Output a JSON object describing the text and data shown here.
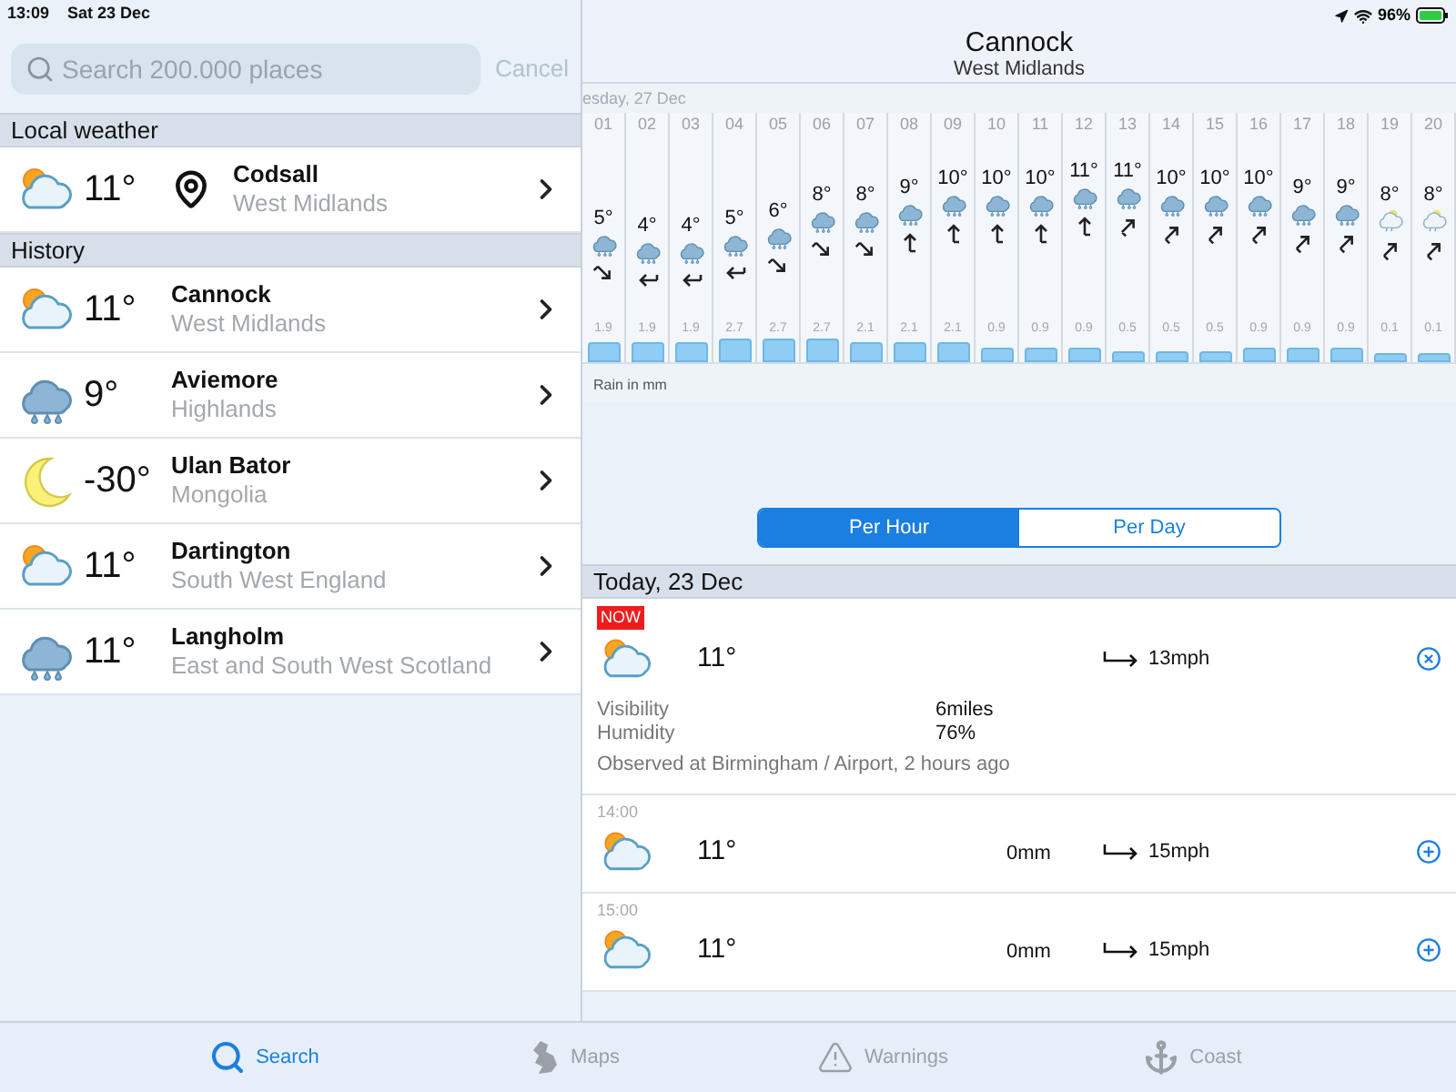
{
  "status_bar": {
    "time": "13:09",
    "date": "Sat 23 Dec",
    "battery": "96%"
  },
  "search": {
    "placeholder": "Search 200.000 places",
    "cancel": "Cancel"
  },
  "sidebar": {
    "sections": [
      {
        "title": "Local weather",
        "places": [
          {
            "kind": "sun_cloud",
            "temp": "11°",
            "name": "Codsall",
            "region": "West Midlands",
            "located": true
          }
        ]
      },
      {
        "title": "History",
        "places": [
          {
            "kind": "sun_cloud",
            "temp": "11°",
            "name": "Cannock",
            "region": "West Midlands",
            "located": false
          },
          {
            "kind": "rain",
            "temp": "9°",
            "name": "Aviemore",
            "region": "Highlands",
            "located": false
          },
          {
            "kind": "moon",
            "temp": "-30°",
            "name": "Ulan Bator",
            "region": "Mongolia",
            "located": false
          },
          {
            "kind": "sun_cloud",
            "temp": "11°",
            "name": "Dartington",
            "region": "South West England",
            "located": false
          },
          {
            "kind": "rain",
            "temp": "11°",
            "name": "Langholm",
            "region": "East and South West Scotland",
            "located": false
          }
        ]
      }
    ]
  },
  "forecast": {
    "title": "Cannock",
    "subtitle": "West Midlands",
    "day_label": "esday, 27 Dec",
    "hours": [
      {
        "hour": "01",
        "temp": "5°",
        "kind": "rain",
        "wind_arrow": {
          "kind": "se"
        },
        "rain": "1.9"
      },
      {
        "hour": "02",
        "temp": "4°",
        "kind": "rain",
        "wind_arrow": {
          "kind": "w"
        },
        "rain": "1.9"
      },
      {
        "hour": "03",
        "temp": "4°",
        "kind": "rain",
        "wind_arrow": {
          "kind": "w"
        },
        "rain": "1.9"
      },
      {
        "hour": "04",
        "temp": "5°",
        "kind": "rain",
        "wind_arrow": {
          "kind": "w"
        },
        "rain": "2.7"
      },
      {
        "hour": "05",
        "temp": "6°",
        "kind": "rain",
        "wind_arrow": {
          "kind": "se"
        },
        "rain": "2.7"
      },
      {
        "hour": "06",
        "temp": "8°",
        "kind": "rain",
        "wind_arrow": {
          "kind": "se"
        },
        "rain": "2.7"
      },
      {
        "hour": "07",
        "temp": "8°",
        "kind": "rain",
        "wind_arrow": {
          "kind": "se"
        },
        "rain": "2.1"
      },
      {
        "hour": "08",
        "temp": "9°",
        "kind": "rain",
        "wind_arrow": {
          "kind": "n"
        },
        "rain": "2.1"
      },
      {
        "hour": "09",
        "temp": "10°",
        "kind": "rain",
        "wind_arrow": {
          "kind": "n"
        },
        "rain": "2.1"
      },
      {
        "hour": "10",
        "temp": "10°",
        "kind": "rain",
        "wind_arrow": {
          "kind": "n"
        },
        "rain": "0.9"
      },
      {
        "hour": "11",
        "temp": "10°",
        "kind": "rain",
        "wind_arrow": {
          "kind": "n"
        },
        "rain": "0.9"
      },
      {
        "hour": "12",
        "temp": "11°",
        "kind": "rain",
        "wind_arrow": {
          "kind": "n"
        },
        "rain": "0.9"
      },
      {
        "hour": "13",
        "temp": "11°",
        "kind": "rain",
        "wind_arrow": {
          "kind": "ne"
        },
        "rain": "0.5"
      },
      {
        "hour": "14",
        "temp": "10°",
        "kind": "rain",
        "wind_arrow": {
          "kind": "ne"
        },
        "rain": "0.5"
      },
      {
        "hour": "15",
        "temp": "10°",
        "kind": "rain",
        "wind_arrow": {
          "kind": "ne"
        },
        "rain": "0.5"
      },
      {
        "hour": "16",
        "temp": "10°",
        "kind": "rain",
        "wind_arrow": {
          "kind": "ne"
        },
        "rain": "0.9"
      },
      {
        "hour": "17",
        "temp": "9°",
        "kind": "rain",
        "wind_arrow": {
          "kind": "ne"
        },
        "rain": "0.9"
      },
      {
        "hour": "18",
        "temp": "9°",
        "kind": "rain",
        "wind_arrow": {
          "kind": "ne"
        },
        "rain": "0.9"
      },
      {
        "hour": "19",
        "temp": "8°",
        "kind": "sun_rain",
        "wind_arrow": {
          "kind": "ne"
        },
        "rain": "0.1"
      },
      {
        "hour": "20",
        "temp": "8°",
        "kind": "sun_rain",
        "wind_arrow": {
          "kind": "ne"
        },
        "rain": "0.1"
      }
    ],
    "rain_caption": "Rain in mm",
    "tabs": [
      {
        "label": "Per Hour",
        "selected": true
      },
      {
        "label": "Per Day",
        "selected": false
      }
    ],
    "day_heading": "Today, 23 Dec",
    "entries": [
      {
        "kind": "now",
        "badge": "NOW",
        "temp": "11°",
        "wind": "13mph",
        "expanded": true,
        "details": [
          {
            "label": "Visibility",
            "value": "6miles"
          },
          {
            "label": "Humidity",
            "value": "76%"
          }
        ],
        "observed": "Observed at Birmingham / Airport, 2 hours ago"
      },
      {
        "kind": "hour",
        "time": "14:00",
        "temp": "11°",
        "rain": "0mm",
        "wind": "15mph",
        "expanded": false
      },
      {
        "kind": "hour",
        "time": "15:00",
        "temp": "11°",
        "rain": "0mm",
        "wind": "15mph",
        "expanded": false
      }
    ]
  },
  "tab_bar": [
    {
      "label": "Search",
      "kind": "search",
      "selected": true
    },
    {
      "label": "Maps",
      "kind": "map",
      "selected": false
    },
    {
      "label": "Warnings",
      "kind": "warning",
      "selected": false
    },
    {
      "label": "Coast",
      "kind": "anchor",
      "selected": false
    }
  ]
}
